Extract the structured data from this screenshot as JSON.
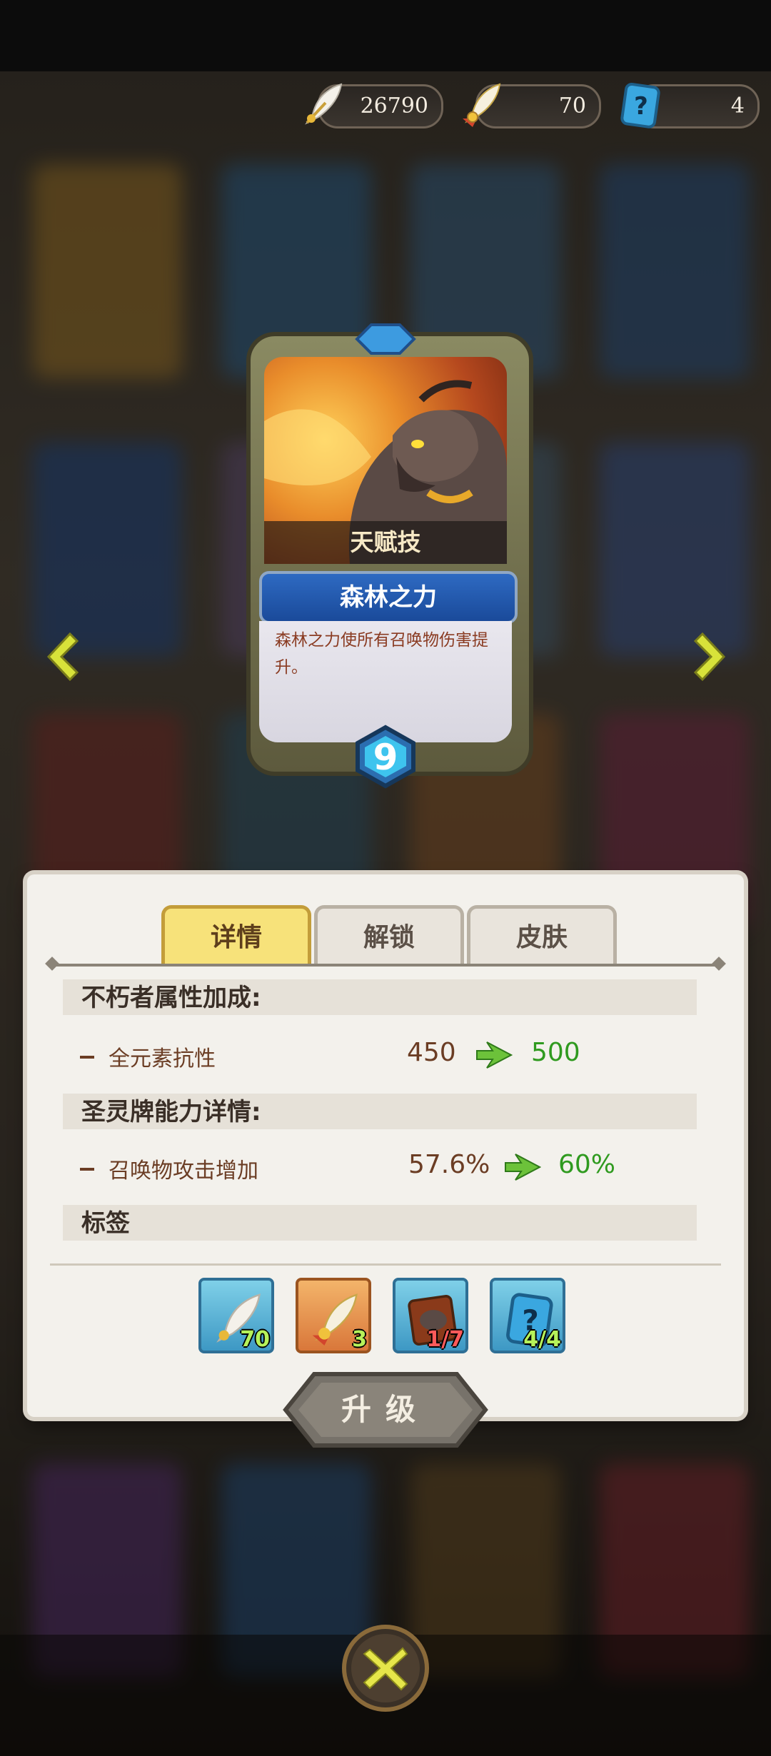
{
  "currencies": [
    {
      "icon": "white-feather-icon",
      "value": "26790"
    },
    {
      "icon": "gold-feather-icon",
      "value": "70"
    },
    {
      "icon": "mystery-card-icon",
      "value": "4"
    }
  ],
  "card": {
    "type_label": "天赋技",
    "name": "森林之力",
    "description": "森林之力使所有召唤物伤害提升。",
    "level": "9"
  },
  "tabs": [
    {
      "label": "详情",
      "active": true
    },
    {
      "label": "解锁",
      "active": false
    },
    {
      "label": "皮肤",
      "active": false
    }
  ],
  "details": {
    "section1_title": "不朽者属性加成:",
    "stat1": {
      "name": "全元素抗性",
      "old": "450",
      "new": "500"
    },
    "section2_title": "圣灵牌能力详情:",
    "stat2": {
      "name": "召唤物攻击增加",
      "old": "57.6%",
      "new": "60%"
    },
    "section3_title": "标签"
  },
  "items": [
    {
      "icon": "white-feather-icon",
      "count": "70",
      "count_color": "#b6f25a"
    },
    {
      "icon": "gold-feather-icon",
      "count": "3",
      "count_color": "#b6f25a"
    },
    {
      "icon": "bear-card-icon",
      "count": "1/7",
      "count_color": "#ff5a5a"
    },
    {
      "icon": "mystery-card-icon",
      "count": "4/4",
      "count_color": "#b6f25a"
    }
  ],
  "upgrade_label": "升级",
  "colors": {
    "tab_active": "#f7e27a",
    "stat_new": "#2f9a1f",
    "stat_old": "#6b3d24",
    "name_bar": "#1a4a9a"
  }
}
